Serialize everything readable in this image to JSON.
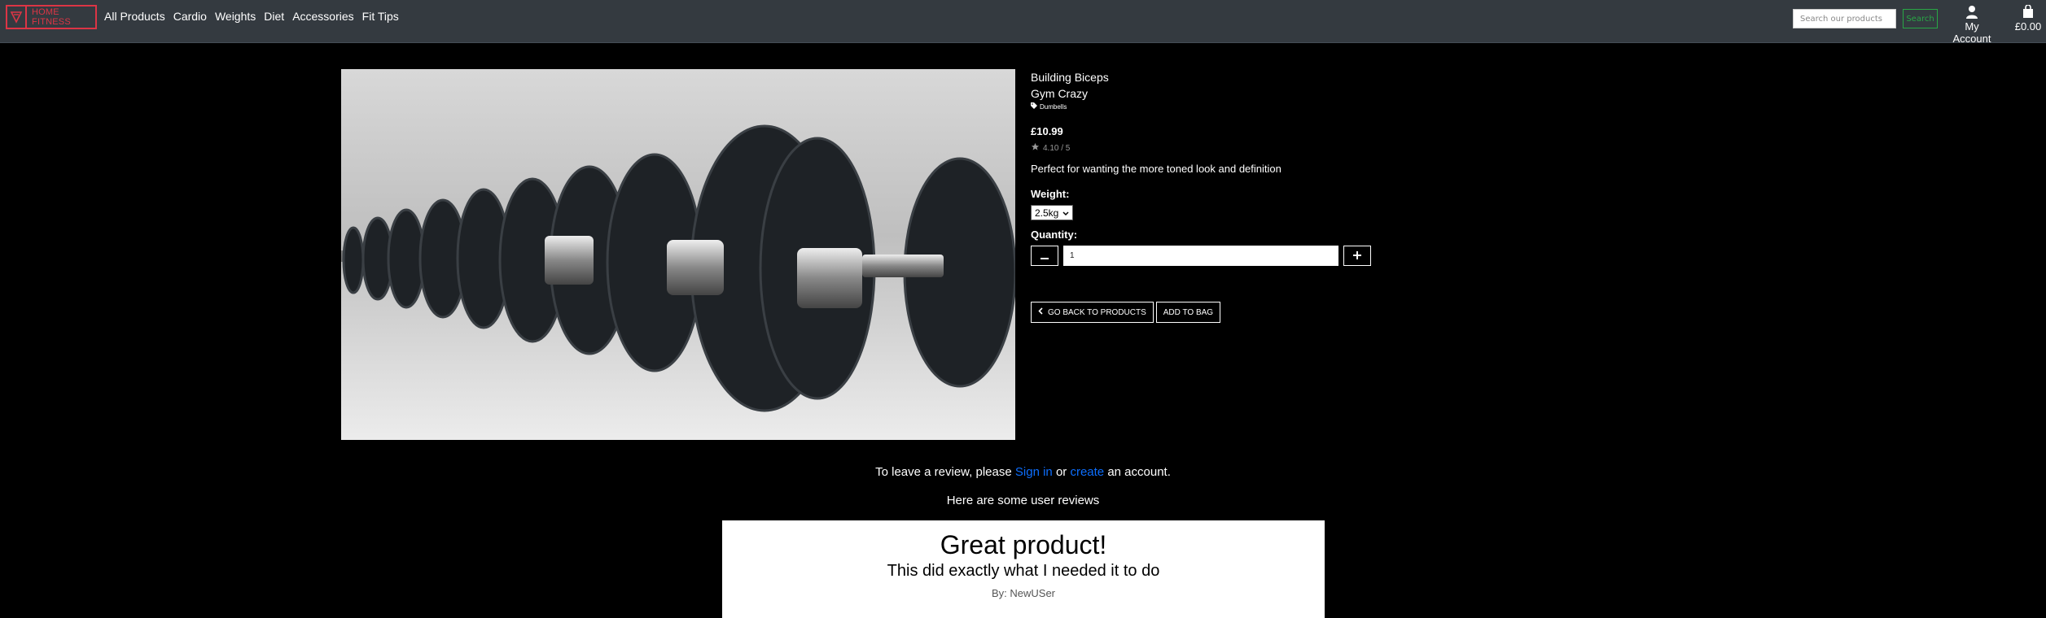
{
  "brand": {
    "name": "HOME FITNESS",
    "accent": "#dc3545"
  },
  "nav": {
    "links": [
      "All Products",
      "Cardio",
      "Weights",
      "Diet",
      "Accessories",
      "Fit Tips"
    ]
  },
  "search": {
    "placeholder": "Search our products",
    "button": "Search"
  },
  "account": {
    "label": "My Account",
    "icon": "user-icon"
  },
  "bag": {
    "total": "£0.00",
    "icon": "shopping-bag-icon"
  },
  "product": {
    "name": "Building Biceps",
    "brand": "Gym Crazy",
    "category": "Dumbells",
    "price": "£10.99",
    "rating": "4.10 / 5",
    "description": "Perfect for wanting the more toned look and definition",
    "weight_label": "Weight:",
    "weight_value": "2.5kg",
    "quantity_label": "Quantity:",
    "quantity_value": "1",
    "back_button": "GO BACK TO PRODUCTS",
    "add_button": "ADD TO BAG"
  },
  "reviews": {
    "prompt_prefix": "To leave a review, please",
    "sign_in": "Sign in",
    "or": "or",
    "create": "create",
    "suffix": "an account.",
    "heading": "Here are some user reviews",
    "items": [
      {
        "title": "Great product!",
        "body": "This did exactly what I needed it to do",
        "author": "By: NewUSer"
      }
    ]
  }
}
